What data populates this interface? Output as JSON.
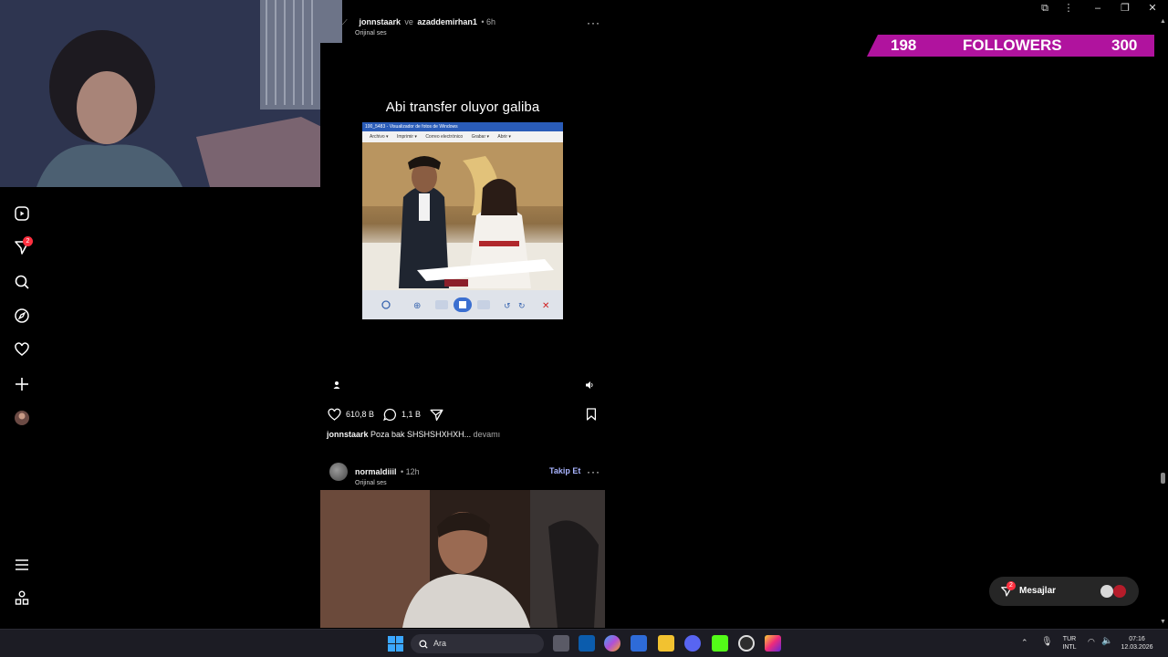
{
  "post1": {
    "username": "jonnstaark",
    "connector": "ve",
    "coauthor": "azaddemirhan1",
    "time": "6h",
    "audio": "Orijinal ses",
    "video_caption": "Abi transfer oluyor galiba",
    "inner_window_title": "100_5483 - Visualizador de fotos de Windows",
    "inner_menu": [
      "Archivo ▾",
      "Imprimir ▾",
      "Correo electrónico",
      "Grabar ▾",
      "Abrir ▾"
    ],
    "likes": "610,8 B",
    "comments": "1,1 B",
    "caption_user": "jonnstaark",
    "caption_text": "Poza bak SHSHSHXHXH...",
    "more": "devamı"
  },
  "post2": {
    "username": "normaldiiil",
    "time": "12h",
    "audio": "Orijinal ses",
    "follow": "Takip Et"
  },
  "sidebar": {
    "notification_count": "2"
  },
  "followers_overlay": {
    "current": "198",
    "label": "FOLLOWERS",
    "goal": "300",
    "accent": "#b0139e"
  },
  "messages": {
    "label": "Mesajlar",
    "badge": "2"
  },
  "taskbar": {
    "search_placeholder": "Ara",
    "lang_line1": "TUR",
    "lang_line2": "INTL",
    "time": "07:16",
    "date": "12.03.2026"
  }
}
